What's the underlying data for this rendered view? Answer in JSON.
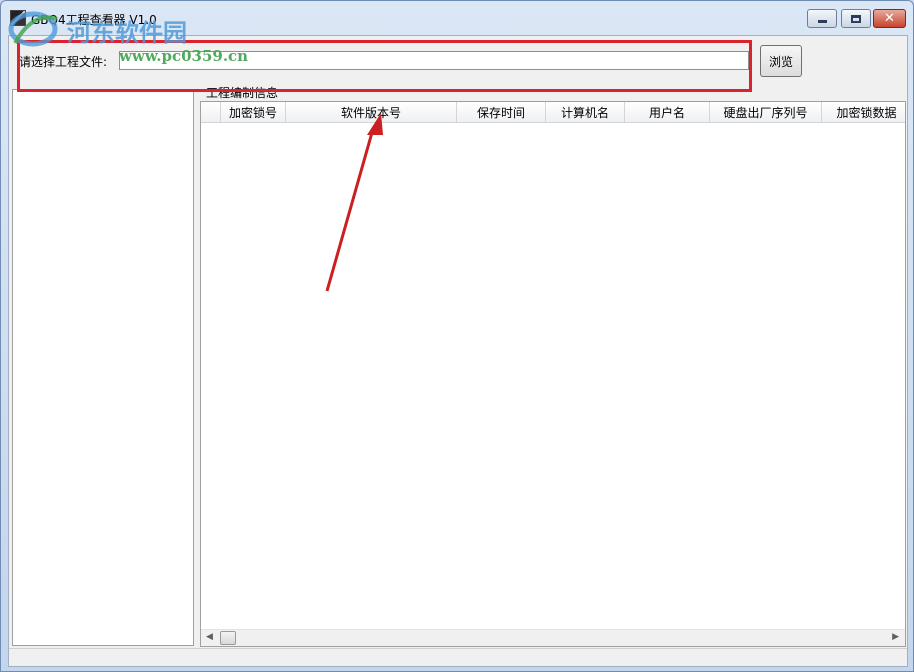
{
  "window": {
    "title": "GBQ4工程查看器 V1.0",
    "minimize_label": "–",
    "close_label": "✕"
  },
  "watermark": {
    "site_name": "河东软件园",
    "url": "www.pc0359.cn"
  },
  "file_select": {
    "label": "请选择工程文件:",
    "value": "",
    "browse_label": "浏览"
  },
  "project_info": {
    "group_label": "工程编制信息",
    "columns": [
      "",
      "加密锁号",
      "软件版本号",
      "保存时间",
      "计算机名",
      "用户名",
      "硬盘出厂序列号",
      "加密锁数据"
    ]
  },
  "colors": {
    "highlight": "#d9232f",
    "arrow": "#cc1f1f"
  }
}
